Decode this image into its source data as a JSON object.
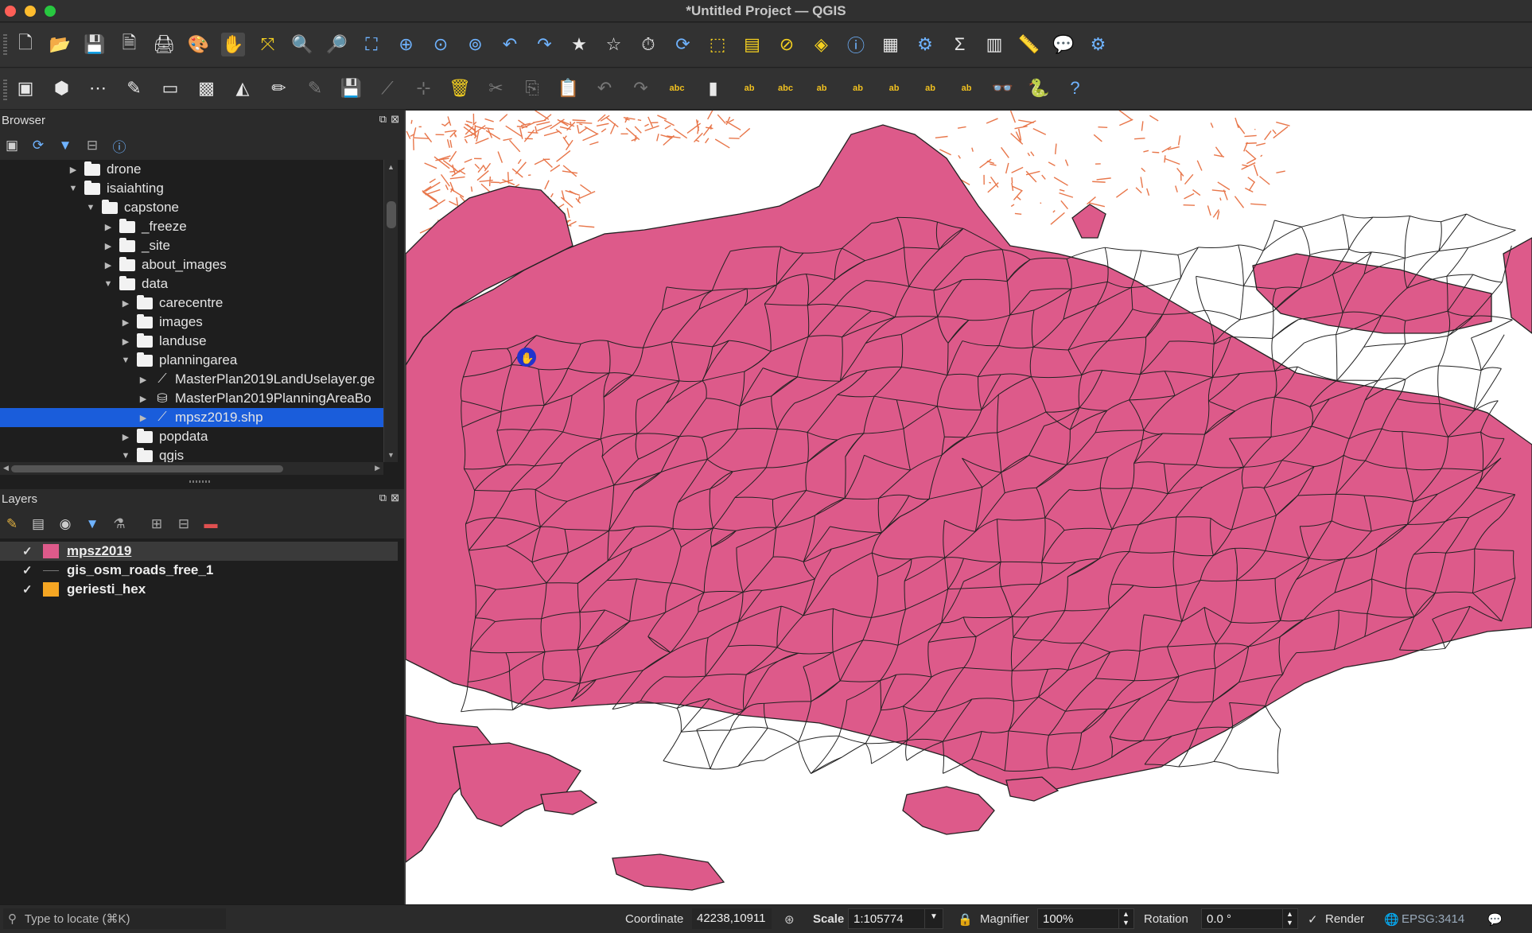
{
  "window": {
    "title": "*Untitled Project — QGIS"
  },
  "toolbar1_icons": [
    "new-project-icon",
    "open-project-icon",
    "save-project-icon",
    "save-as-icon",
    "print-layout-icon",
    "style-manager-icon",
    "pan-icon",
    "pan-to-selection-icon",
    "zoom-in-icon",
    "zoom-out-icon",
    "zoom-full-icon",
    "zoom-to-selection-icon",
    "zoom-to-layer-icon",
    "zoom-native-icon",
    "zoom-last-icon",
    "zoom-next-icon",
    "new-bookmark-icon",
    "show-bookmarks-icon",
    "temporal-controller-icon",
    "refresh-icon",
    "select-features-icon",
    "select-by-value-icon",
    "deselect-icon",
    "select-by-location-icon",
    "identify-icon",
    "open-attribute-table-icon",
    "toolbox-icon",
    "statistics-icon",
    "field-calculator-icon",
    "measure-icon",
    "annotation-icon",
    "settings-icon"
  ],
  "toolbar2_icons": [
    "data-source-manager-icon",
    "new-geopackage-icon",
    "new-temporary-layer-icon",
    "digitize-icon",
    "add-layer-icon",
    "virtual-layer-icon",
    "new-mesh-icon",
    "edit-pencil-icon",
    "toggle-editing-icon",
    "save-edits-icon",
    "digitize-line-icon",
    "vertex-tool-icon",
    "delete-selected-icon",
    "cut-icon",
    "copy-icon",
    "paste-icon",
    "undo-icon",
    "redo-icon",
    "label-icon",
    "diagram-icon",
    "label-pin-icon",
    "label-highlight-icon",
    "label-move-icon",
    "label-rotate-icon",
    "label-change-icon",
    "label-show-icon",
    "label-hide-icon",
    "plugin-icon",
    "python-icon",
    "help-icon"
  ],
  "browser": {
    "header": "Browser",
    "items": [
      {
        "label": "drone",
        "indent": 0,
        "expanded": false,
        "kind": "folder"
      },
      {
        "label": "isaiahting",
        "indent": 0,
        "expanded": true,
        "kind": "folder"
      },
      {
        "label": "capstone",
        "indent": 1,
        "expanded": true,
        "kind": "folder"
      },
      {
        "label": "_freeze",
        "indent": 2,
        "expanded": false,
        "kind": "folder"
      },
      {
        "label": "_site",
        "indent": 2,
        "expanded": false,
        "kind": "folder"
      },
      {
        "label": "about_images",
        "indent": 2,
        "expanded": false,
        "kind": "folder"
      },
      {
        "label": "data",
        "indent": 2,
        "expanded": true,
        "kind": "folder"
      },
      {
        "label": "carecentre",
        "indent": 3,
        "expanded": false,
        "kind": "folder"
      },
      {
        "label": "images",
        "indent": 3,
        "expanded": false,
        "kind": "folder"
      },
      {
        "label": "landuse",
        "indent": 3,
        "expanded": false,
        "kind": "folder"
      },
      {
        "label": "planningarea",
        "indent": 3,
        "expanded": true,
        "kind": "folder"
      },
      {
        "label": "MasterPlan2019LandUselayer.ge",
        "indent": 4,
        "expanded": false,
        "kind": "vector"
      },
      {
        "label": "MasterPlan2019PlanningAreaBo",
        "indent": 4,
        "expanded": false,
        "kind": "db"
      },
      {
        "label": "mpsz2019.shp",
        "indent": 4,
        "expanded": false,
        "kind": "vector",
        "selected": true
      },
      {
        "label": "popdata",
        "indent": 3,
        "expanded": false,
        "kind": "folder"
      },
      {
        "label": "qgis",
        "indent": 3,
        "expanded": true,
        "kind": "folder"
      }
    ]
  },
  "layers": {
    "header": "Layers",
    "items": [
      {
        "name": "mpsz2019",
        "color": "#dd5a8a",
        "swatch": "fill",
        "active": true
      },
      {
        "name": "gis_osm_roads_free_1",
        "color": "#777777",
        "swatch": "line",
        "active": false
      },
      {
        "name": "geriesti_hex",
        "color": "#f5a623",
        "swatch": "fill",
        "active": false
      }
    ]
  },
  "status": {
    "locator_placeholder": "Type to locate (⌘K)",
    "coordinate_label": "Coordinate",
    "coordinate_value": "42238,10911",
    "scale_label": "Scale",
    "scale_value": "1:105774",
    "magnifier_label": "Magnifier",
    "magnifier_value": "100%",
    "rotation_label": "Rotation",
    "rotation_value": "0.0 °",
    "render_label": "Render",
    "crs": "EPSG:3414"
  },
  "colors": {
    "map_fill": "#dd5a8a",
    "roads": "#e8764a",
    "selection": "#1a5ddb"
  }
}
